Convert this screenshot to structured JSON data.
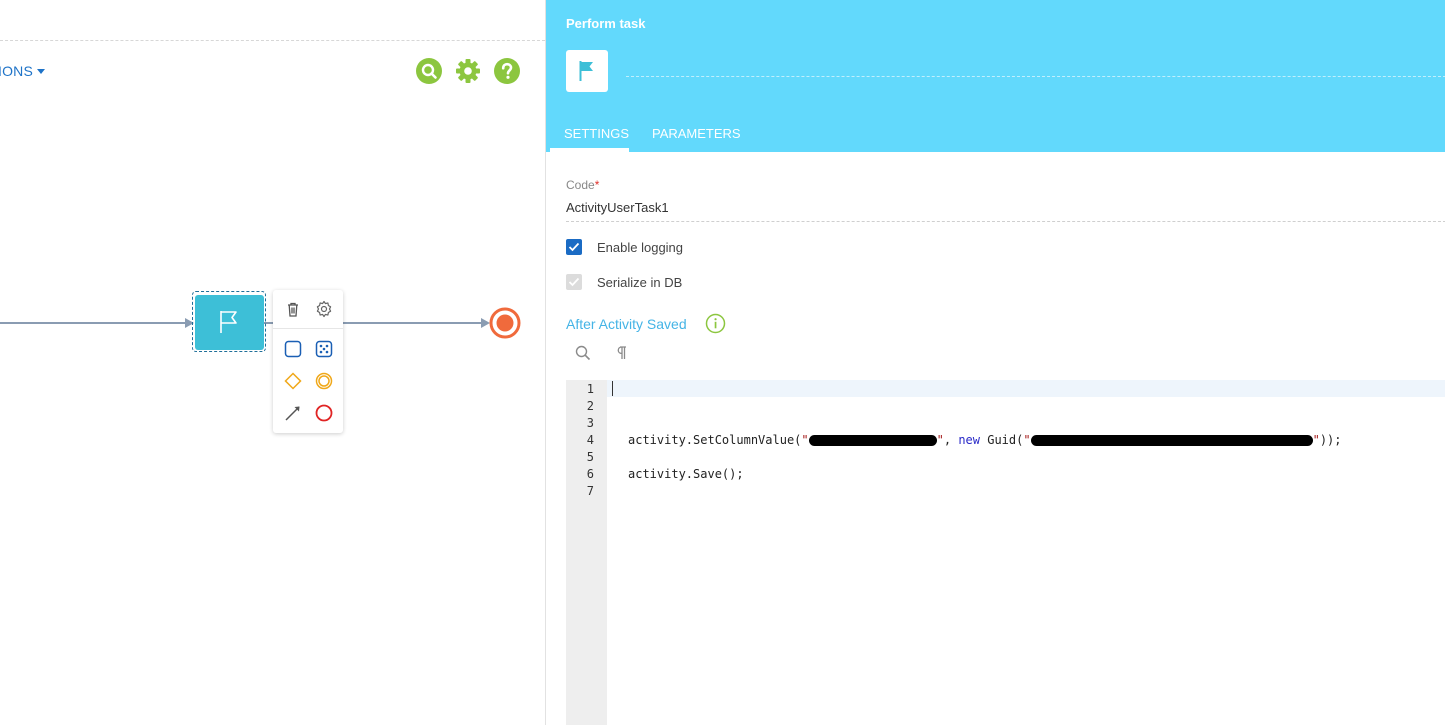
{
  "canvas": {
    "actions_label": "IONS",
    "icons": [
      "search-icon",
      "gear-icon",
      "help-icon"
    ],
    "accent_color": "#8cc63f"
  },
  "task_element": {
    "icon": "flag-icon",
    "color": "#3dbfd7"
  },
  "mini_toolbar": {
    "icons": [
      "trash-icon",
      "gear-icon",
      "task-shape-icon",
      "subprocess-icon",
      "gateway-icon",
      "intermediate-event-icon",
      "connector-icon",
      "end-event-icon"
    ]
  },
  "panel": {
    "title": "Perform task",
    "header_color": "#62d9fc",
    "tabs": [
      {
        "label": "SETTINGS",
        "active": true
      },
      {
        "label": "PARAMETERS",
        "active": false
      }
    ],
    "code_field": {
      "label": "Code",
      "required_mark": "*",
      "value": "ActivityUserTask1"
    },
    "checkboxes": [
      {
        "label": "Enable logging",
        "checked": true,
        "enabled": true
      },
      {
        "label": "Serialize in DB",
        "checked": true,
        "enabled": false
      }
    ],
    "script_section": {
      "title": "After Activity Saved"
    },
    "editor": {
      "line_numbers": [
        "1",
        "2",
        "3",
        "4",
        "5",
        "6",
        "7"
      ],
      "line4": {
        "prefix": "activity.SetColumnValue(",
        "str_open": "\"",
        "str_close": "\"",
        "sep": ", ",
        "keyword": "new",
        "guid_call": " Guid(",
        "suffix": "));"
      },
      "line6": "activity.Save();"
    }
  }
}
